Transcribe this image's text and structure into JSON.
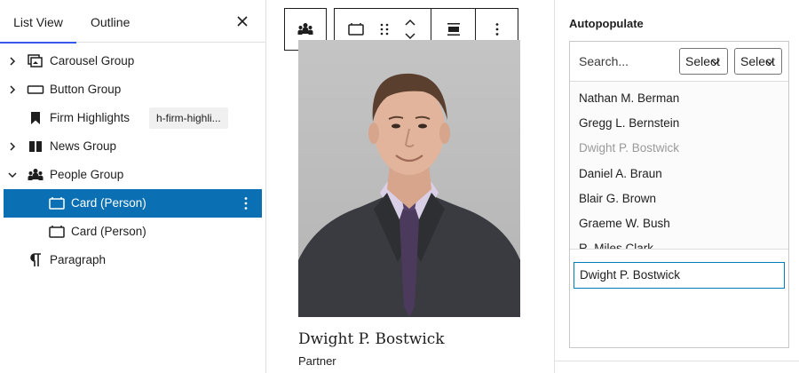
{
  "sidebar": {
    "tabs": {
      "list_view": "List View",
      "outline": "Outline"
    },
    "close_icon": "close-icon",
    "items": [
      {
        "label": "Carousel Group",
        "icon": "carousel-icon",
        "expandable": true,
        "selected": false
      },
      {
        "label": "Button Group",
        "icon": "button-icon",
        "expandable": true,
        "selected": false
      },
      {
        "label": "Firm Highlights",
        "icon": "bookmark-icon",
        "expandable": false,
        "selected": false,
        "anchor": "h-firm-highli..."
      },
      {
        "label": "News Group",
        "icon": "columns-icon",
        "expandable": true,
        "selected": false
      },
      {
        "label": "People Group",
        "icon": "people-icon",
        "expandable": true,
        "expanded": true,
        "selected": false
      },
      {
        "label": "Card (Person)",
        "icon": "card-icon",
        "expandable": false,
        "selected": true
      },
      {
        "label": "Card (Person)",
        "icon": "card-icon",
        "expandable": false,
        "selected": false
      },
      {
        "label": "Paragraph",
        "icon": "paragraph-icon",
        "expandable": false,
        "selected": false
      }
    ],
    "selected_color": "#0a70b3"
  },
  "toolbar": {
    "buttons": [
      "people-icon",
      "card-icon",
      "drag-handle-icon",
      "move-up-down-icon",
      "align-icon",
      "more-options-icon"
    ]
  },
  "card": {
    "name": "Dwight P. Bostwick",
    "title": "Partner",
    "image": "portrait-photo"
  },
  "autopopulate": {
    "title": "Autopopulate",
    "search_placeholder": "Search...",
    "select_label_1": "Select",
    "select_label_2": "Select",
    "items": [
      {
        "name": "Nathan M. Berman",
        "dim": false
      },
      {
        "name": "Gregg L. Bernstein",
        "dim": false
      },
      {
        "name": "Dwight P. Bostwick",
        "dim": true
      },
      {
        "name": "Daniel A. Braun",
        "dim": false
      },
      {
        "name": "Blair G. Brown",
        "dim": false
      },
      {
        "name": "Graeme W. Bush",
        "dim": false
      },
      {
        "name": "R. Miles Clark",
        "dim": false
      }
    ],
    "selected": "Dwight P. Bostwick",
    "accent_color": "#007cba"
  }
}
